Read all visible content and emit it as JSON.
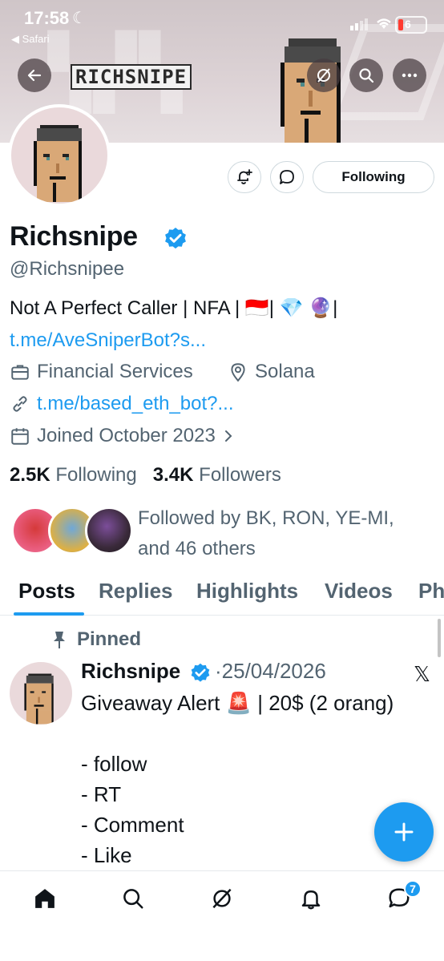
{
  "status_bar": {
    "time": "17:58",
    "back_app": "◀ Safari",
    "battery": "6"
  },
  "header": {
    "brand": "RICHSNIPE"
  },
  "profile": {
    "name": "Richsnipe",
    "handle": "@Richsnipee",
    "bio": "Not A Perfect Caller | NFA | 🇮🇩| 💎 🔮|",
    "bio_link": "t.me/AveSniperBot?s...",
    "category": "Financial Services",
    "location": "Solana",
    "website": "t.me/based_eth_bot?...",
    "joined": "Joined October 2023",
    "following_count": "2.5K",
    "following_label": "Following",
    "followers_count": "3.4K",
    "followers_label": "Followers",
    "followed_by_line1": "Followed by BK, RON, YE-MI,",
    "followed_by_line2": "and 46 others",
    "follow_button": "Following"
  },
  "tabs": [
    "Posts",
    "Replies",
    "Highlights",
    "Videos",
    "Ph"
  ],
  "pinned_post": {
    "pinned_label": "Pinned",
    "author": "Richsnipe",
    "date": "·25/04/2026",
    "lines": [
      "Giveaway Alert 🚨 | 20$ (2 orang)",
      "",
      "- follow",
      "- RT",
      "- Comment",
      "- Like"
    ]
  },
  "bottom_nav": {
    "messages_badge": "7"
  },
  "colors": {
    "accent": "#1d9bf0",
    "text_primary": "#0f1419",
    "text_secondary": "#536471"
  }
}
